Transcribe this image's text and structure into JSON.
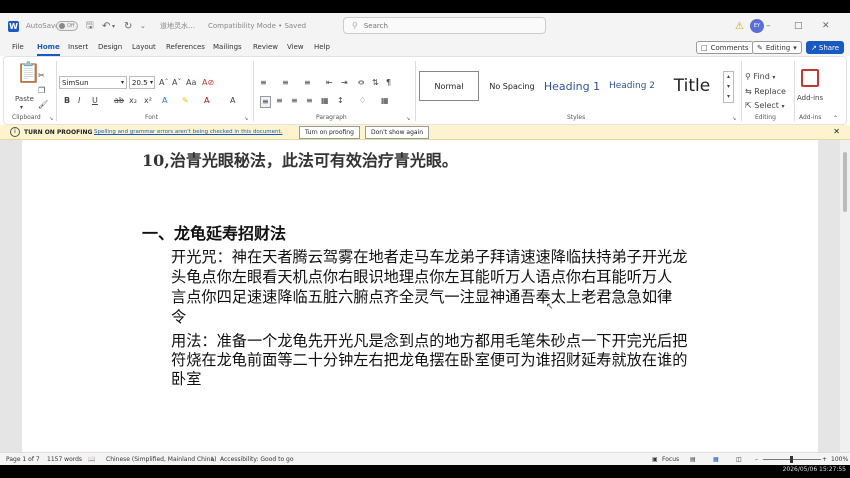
{
  "titlebar": {
    "autosave_label": "AutoSave",
    "autosave_state": "Off",
    "doc_title": "道地灵水…",
    "mode": "Compatibility Mode • Saved",
    "search_placeholder": "Search",
    "user_initials": "EY"
  },
  "menu": {
    "items": [
      "File",
      "Home",
      "Insert",
      "Design",
      "Layout",
      "References",
      "Mailings",
      "Review",
      "View",
      "Help"
    ],
    "active": "Home",
    "comments_label": "Comments",
    "editing_label": "Editing",
    "share_label": "Share"
  },
  "ribbon": {
    "paste_label": "Paste",
    "font_name": "SimSun",
    "font_size": "20.5",
    "styles": [
      "Normal",
      "No Spacing",
      "Heading 1",
      "Heading 2",
      "Title"
    ],
    "find_label": "Find",
    "replace_label": "Replace",
    "select_label": "Select",
    "addins_label": "Add-ins",
    "group_labels": {
      "clipboard": "Clipboard",
      "font": "Font",
      "paragraph": "Paragraph",
      "styles": "Styles",
      "editing": "Editing",
      "addins": "Add-ins"
    }
  },
  "proofing": {
    "title": "TURN ON PROOFING",
    "message": "Spelling and grammar errors aren't being checked in this document.",
    "turn_on_button": "Turn on proofing",
    "dismiss_button": "Don't show again"
  },
  "document": {
    "line1": "10,治青光眼秘法，此法可有效治疗青光眼。",
    "heading": "一、龙龟延寿招财法",
    "p1": [
      "开光咒：神在天者腾云驾雾在地者走马车龙弟子拜请速速降临扶持弟子开光龙",
      "头龟点你左眼看天机点你右眼识地理点你左耳能听万人语点你右耳能听万人",
      "言点你四足速速降临五脏六腑点齐全灵气一注显神通吾奉太上老君急急如律",
      "令"
    ],
    "p2": [
      "用法：准备一个龙龟先开光凡是念到点的地方都用毛笔朱砂点一下开完光后把",
      "符烧在龙龟前面等二十分钟左右把龙龟摆在卧室便可为谁招财延寿就放在谁的",
      "卧室"
    ]
  },
  "status": {
    "page": "Page 1 of 7",
    "words": "1157 words",
    "language": "Chinese (Simplified, Mainland China)",
    "accessibility": "Accessibility: Good to go",
    "focus": "Focus",
    "zoom": "100%"
  },
  "taskbar": {
    "datetime": "2026/05/06 15:27:55"
  },
  "colors": {
    "accent": "#185abd",
    "proof_bg": "#fdf3cf",
    "doc_bg": "#e5e5e5"
  }
}
